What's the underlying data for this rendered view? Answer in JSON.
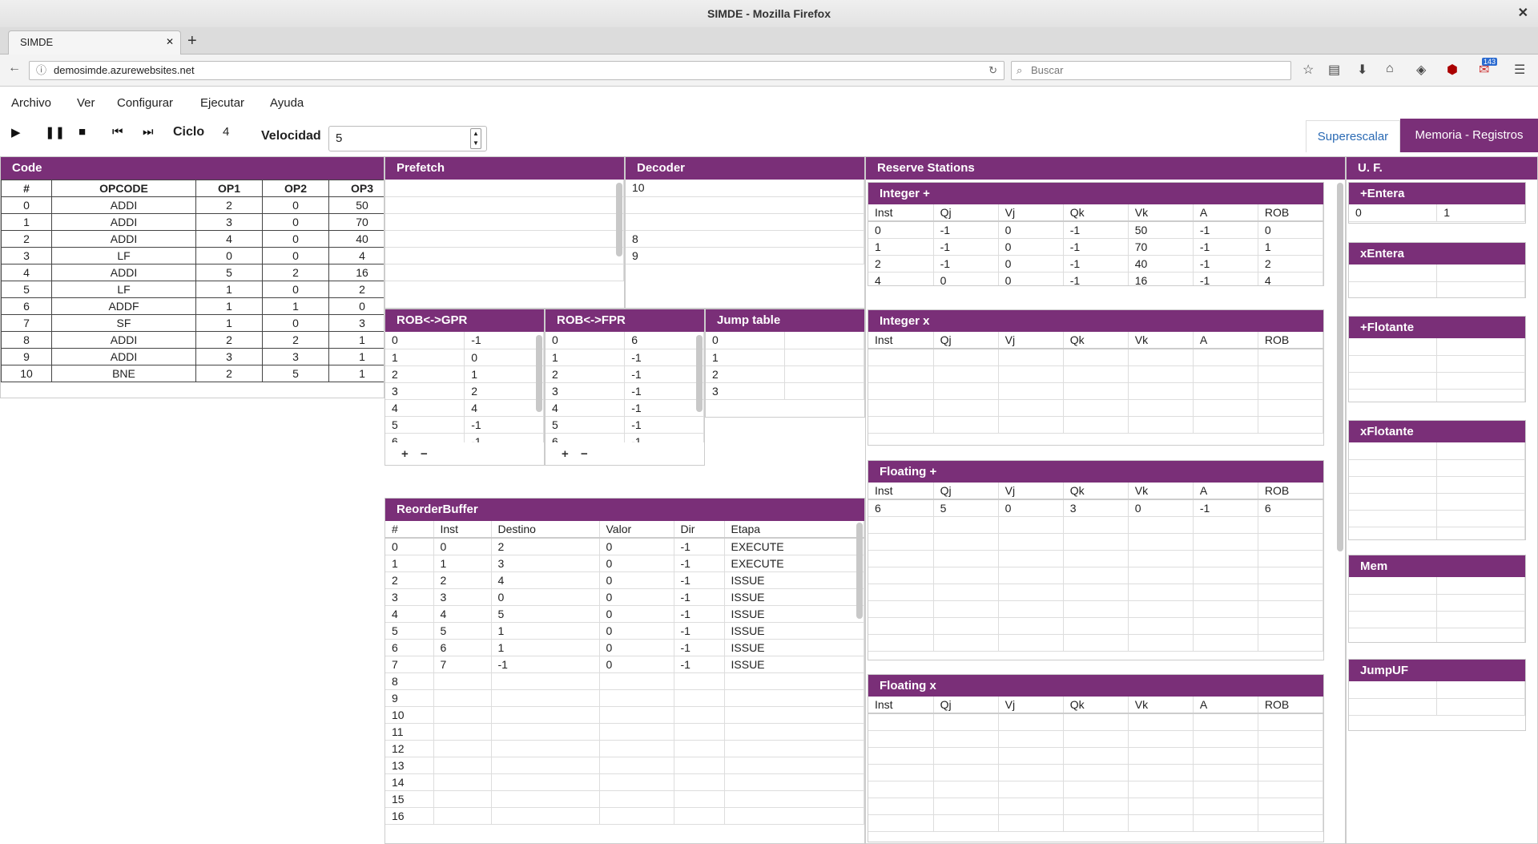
{
  "window": {
    "title": "SIMDE - Mozilla Firefox"
  },
  "tab": {
    "label": "SIMDE"
  },
  "url": "demosimde.azurewebsites.net",
  "search_placeholder": "Buscar",
  "badge": "143",
  "menu": [
    "Archivo",
    "Ver",
    "Configurar",
    "Ejecutar",
    "Ayuda"
  ],
  "toolbar": {
    "ciclo_label": "Ciclo",
    "ciclo_value": "4",
    "velocidad_label": "Velocidad",
    "velocidad_value": "5",
    "superescalar": "Superescalar",
    "memoria": "Memoria - Registros"
  },
  "code": {
    "title": "Code",
    "headers": [
      "#",
      "OPCODE",
      "OP1",
      "OP2",
      "OP3"
    ],
    "rows": [
      [
        "0",
        "ADDI",
        "2",
        "0",
        "50"
      ],
      [
        "1",
        "ADDI",
        "3",
        "0",
        "70"
      ],
      [
        "2",
        "ADDI",
        "4",
        "0",
        "40"
      ],
      [
        "3",
        "LF",
        "0",
        "0",
        "4"
      ],
      [
        "4",
        "ADDI",
        "5",
        "2",
        "16"
      ],
      [
        "5",
        "LF",
        "1",
        "0",
        "2"
      ],
      [
        "6",
        "ADDF",
        "1",
        "1",
        "0"
      ],
      [
        "7",
        "SF",
        "1",
        "0",
        "3"
      ],
      [
        "8",
        "ADDI",
        "2",
        "2",
        "1"
      ],
      [
        "9",
        "ADDI",
        "3",
        "3",
        "1"
      ],
      [
        "10",
        "BNE",
        "2",
        "5",
        "1"
      ]
    ]
  },
  "prefetch": {
    "title": "Prefetch"
  },
  "decoder": {
    "title": "Decoder",
    "rows": [
      "10",
      "",
      "",
      "8",
      "9"
    ]
  },
  "rob_gpr": {
    "title": "ROB<->GPR",
    "rows": [
      [
        "0",
        "-1"
      ],
      [
        "1",
        "0"
      ],
      [
        "2",
        "1"
      ],
      [
        "3",
        "2"
      ],
      [
        "4",
        "4"
      ],
      [
        "5",
        "-1"
      ],
      [
        "6",
        "-1"
      ]
    ]
  },
  "rob_fpr": {
    "title": "ROB<->FPR",
    "rows": [
      [
        "0",
        "6"
      ],
      [
        "1",
        "-1"
      ],
      [
        "2",
        "-1"
      ],
      [
        "3",
        "-1"
      ],
      [
        "4",
        "-1"
      ],
      [
        "5",
        "-1"
      ],
      [
        "6",
        "-1"
      ]
    ]
  },
  "jump": {
    "title": "Jump table",
    "rows": [
      "0",
      "1",
      "2",
      "3"
    ]
  },
  "reserve": {
    "title": "Reserve Stations",
    "headers": [
      "Inst",
      "Qj",
      "Vj",
      "Qk",
      "Vk",
      "A",
      "ROB"
    ],
    "integer_plus": {
      "title": "Integer +",
      "rows": [
        [
          "0",
          "-1",
          "0",
          "-1",
          "50",
          "-1",
          "0"
        ],
        [
          "1",
          "-1",
          "0",
          "-1",
          "70",
          "-1",
          "1"
        ],
        [
          "2",
          "-1",
          "0",
          "-1",
          "40",
          "-1",
          "2"
        ],
        [
          "4",
          "0",
          "0",
          "-1",
          "16",
          "-1",
          "4"
        ]
      ]
    },
    "integer_x": {
      "title": "Integer x"
    },
    "floating_plus": {
      "title": "Floating +",
      "rows": [
        [
          "6",
          "5",
          "0",
          "3",
          "0",
          "-1",
          "6"
        ]
      ]
    },
    "floating_x": {
      "title": "Floating x"
    }
  },
  "rob": {
    "title": "ReorderBuffer",
    "headers": [
      "#",
      "Inst",
      "Destino",
      "Valor",
      "Dir",
      "Etapa"
    ],
    "rows": [
      [
        "0",
        "0",
        "2",
        "0",
        "-1",
        "EXECUTE"
      ],
      [
        "1",
        "1",
        "3",
        "0",
        "-1",
        "EXECUTE"
      ],
      [
        "2",
        "2",
        "4",
        "0",
        "-1",
        "ISSUE"
      ],
      [
        "3",
        "3",
        "0",
        "0",
        "-1",
        "ISSUE"
      ],
      [
        "4",
        "4",
        "5",
        "0",
        "-1",
        "ISSUE"
      ],
      [
        "5",
        "5",
        "1",
        "0",
        "-1",
        "ISSUE"
      ],
      [
        "6",
        "6",
        "1",
        "0",
        "-1",
        "ISSUE"
      ],
      [
        "7",
        "7",
        "-1",
        "0",
        "-1",
        "ISSUE"
      ],
      [
        "8",
        "",
        "",
        "",
        "",
        ""
      ],
      [
        "9",
        "",
        "",
        "",
        "",
        ""
      ],
      [
        "10",
        "",
        "",
        "",
        "",
        ""
      ],
      [
        "11",
        "",
        "",
        "",
        "",
        ""
      ],
      [
        "12",
        "",
        "",
        "",
        "",
        ""
      ],
      [
        "13",
        "",
        "",
        "",
        "",
        ""
      ],
      [
        "14",
        "",
        "",
        "",
        "",
        ""
      ],
      [
        "15",
        "",
        "",
        "",
        "",
        ""
      ],
      [
        "16",
        "",
        "",
        "",
        "",
        ""
      ]
    ]
  },
  "uf": {
    "title": "U. F.",
    "entera_plus": {
      "title": "+Entera",
      "row": [
        "0",
        "1"
      ]
    },
    "entera_x": {
      "title": "xEntera"
    },
    "flotante_plus": {
      "title": "+Flotante"
    },
    "flotante_x": {
      "title": "xFlotante"
    },
    "mem": {
      "title": "Mem"
    },
    "jump": {
      "title": "JumpUF"
    }
  },
  "colors": {
    "accent": "#7a2f78",
    "link": "#2a6ab4"
  }
}
